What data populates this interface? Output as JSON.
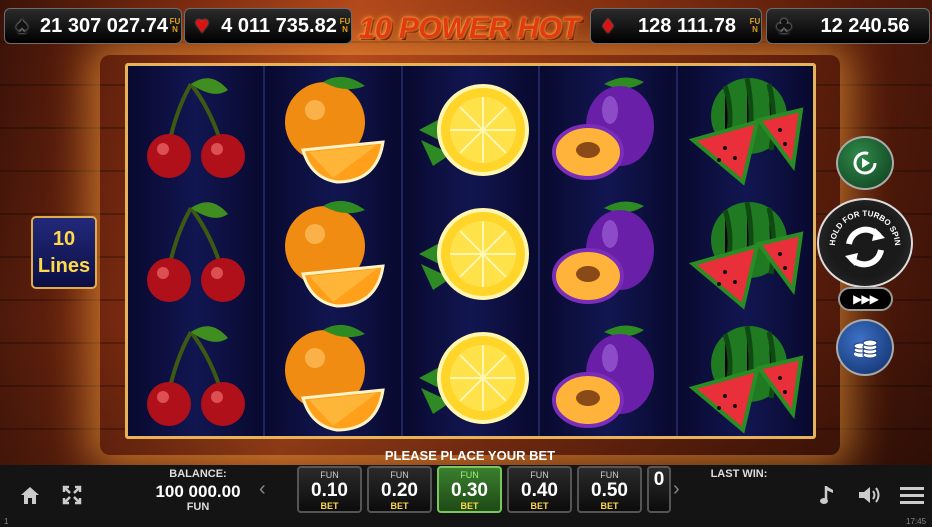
{
  "jackpots": [
    {
      "suit": "spade",
      "value": "21 307 027.74",
      "tag": "FUN"
    },
    {
      "suit": "heart",
      "value": "4 011 735.82",
      "tag": "FUN"
    },
    {
      "suit": "diamond",
      "value": "128 111.78",
      "tag": "FUN"
    },
    {
      "suit": "club",
      "value": "12 240.56",
      "tag": "FUN"
    }
  ],
  "game_title": "10 POWER HOT",
  "lines_badge": {
    "count": "10",
    "label": "Lines"
  },
  "reels": [
    [
      "cherry",
      "cherry",
      "cherry"
    ],
    [
      "orange",
      "orange",
      "orange"
    ],
    [
      "lemon",
      "lemon",
      "lemon"
    ],
    [
      "plum",
      "plum",
      "plum"
    ],
    [
      "watermelon",
      "watermelon",
      "watermelon"
    ]
  ],
  "controls": {
    "spin_caption": "HOLD FOR TURBO SPIN",
    "turbo_label": "▶▶▶"
  },
  "message": "PLEASE PLACE YOUR BET",
  "balance": {
    "label": "BALANCE:",
    "value": "100 000.00",
    "currency": "FUN"
  },
  "bets": [
    {
      "tag": "FUN",
      "value": "0.10",
      "unit": "BET",
      "selected": false
    },
    {
      "tag": "FUN",
      "value": "0.20",
      "unit": "BET",
      "selected": false
    },
    {
      "tag": "FUN",
      "value": "0.30",
      "unit": "BET",
      "selected": true
    },
    {
      "tag": "FUN",
      "value": "0.40",
      "unit": "BET",
      "selected": false
    },
    {
      "tag": "FUN",
      "value": "0.50",
      "unit": "BET",
      "selected": false
    },
    {
      "tag": "",
      "value": "0",
      "unit": "",
      "selected": false
    }
  ],
  "last_win": {
    "label": "LAST WIN:",
    "value": ""
  },
  "status": {
    "left": "1",
    "clock": "17:45"
  },
  "icons": {
    "home": "home-icon",
    "fullscreen": "fullscreen-icon",
    "music": "music-note-icon",
    "sound": "speaker-icon",
    "menu": "hamburger-menu-icon",
    "autoplay": "autoplay-icon",
    "spin": "spin-arrows-icon",
    "coins": "coin-stack-icon"
  }
}
